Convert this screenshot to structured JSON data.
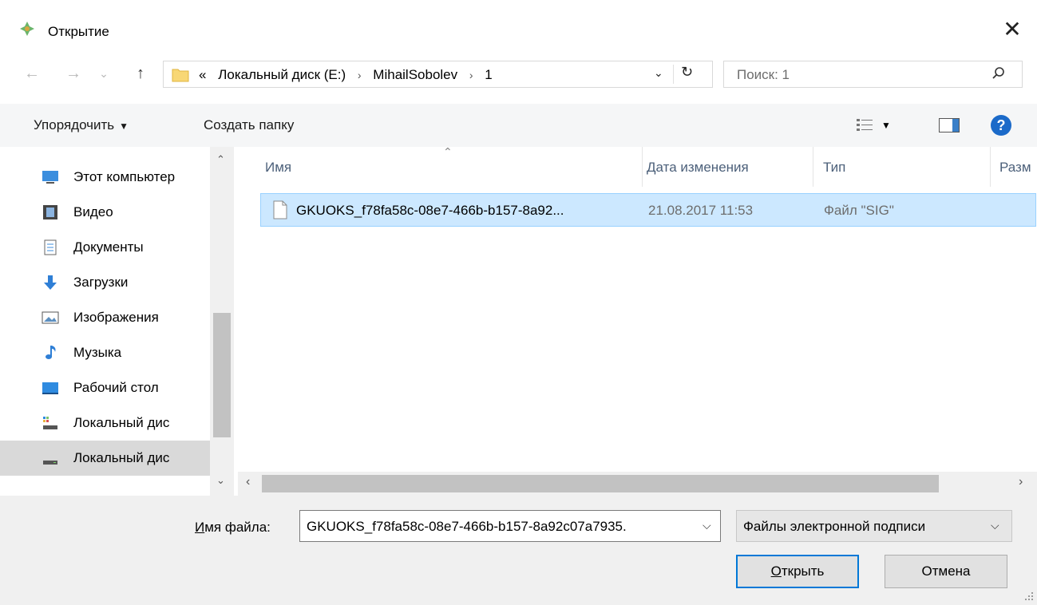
{
  "window": {
    "title": "Открытие",
    "close_glyph": "✕"
  },
  "nav": {
    "back_glyph": "←",
    "forward_glyph": "→",
    "recent_glyph": "⌄",
    "up_glyph": "↑",
    "address": {
      "prefix": "«",
      "crumbs": [
        "Локальный диск (E:)",
        "MihailSobolev",
        "1"
      ],
      "separator": "›"
    },
    "dropdown_glyph": "⌄",
    "refresh_glyph": "↻",
    "search_placeholder": "Поиск: 1"
  },
  "toolbar": {
    "organize_label": "Упорядочить",
    "new_folder_label": "Создать папку",
    "caret": "▼",
    "help_label": "?"
  },
  "sidebar": {
    "items": [
      {
        "label": "Этот компьютер",
        "icon": "computer-icon"
      },
      {
        "label": "Видео",
        "icon": "video-icon"
      },
      {
        "label": "Документы",
        "icon": "documents-icon"
      },
      {
        "label": "Загрузки",
        "icon": "downloads-icon"
      },
      {
        "label": "Изображения",
        "icon": "pictures-icon"
      },
      {
        "label": "Музыка",
        "icon": "music-icon"
      },
      {
        "label": "Рабочий стол",
        "icon": "desktop-icon"
      },
      {
        "label": "Локальный дис",
        "icon": "drive-icon"
      },
      {
        "label": "Локальный дис",
        "icon": "drive-icon"
      }
    ],
    "selected_index": 8
  },
  "filelist": {
    "columns": [
      "Имя",
      "Дата изменения",
      "Тип",
      "Разм"
    ],
    "rows": [
      {
        "name": "GKUOKS_f78fa58c-08e7-466b-b157-8a92...",
        "date": "21.08.2017 11:53",
        "type": "Файл \"SIG\""
      }
    ]
  },
  "bottom": {
    "filename_label": "Имя файла:",
    "filename_value": "GKUOKS_f78fa58c-08e7-466b-b157-8a92c07a7935.",
    "filter_value": "Файлы электронной подписи",
    "open_label": "Открыть",
    "cancel_label": "Отмена",
    "caret": "⌵"
  },
  "colors": {
    "selection_bg": "#cce8ff",
    "selection_border": "#99d1ff",
    "accent": "#0078d7"
  }
}
